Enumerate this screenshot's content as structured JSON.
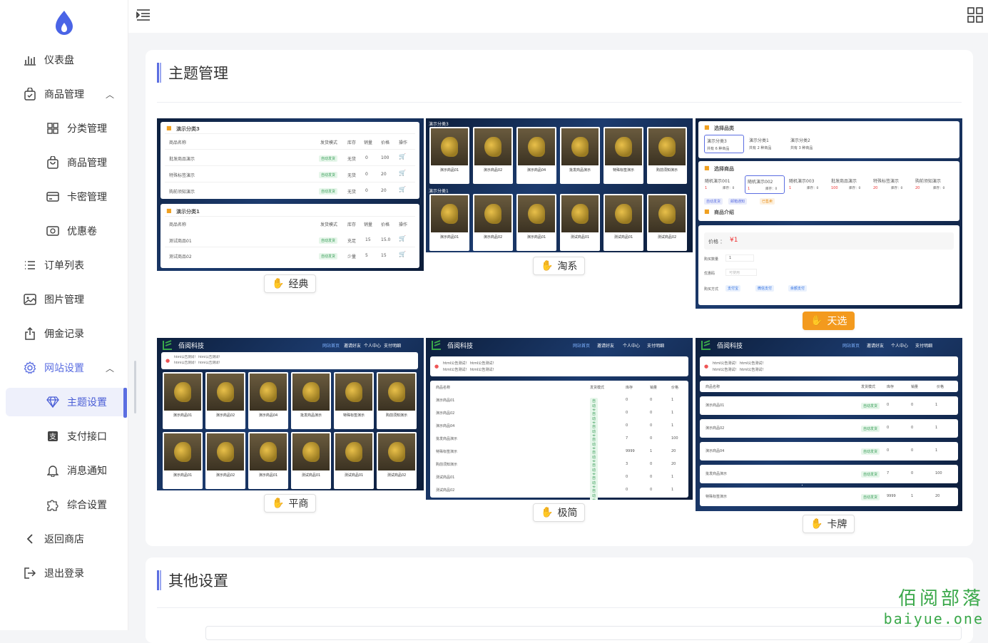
{
  "sidebar": {
    "items": [
      {
        "label": "仪表盘"
      },
      {
        "label": "商品管理"
      },
      {
        "label": "分类管理"
      },
      {
        "label": "商品管理"
      },
      {
        "label": "卡密管理"
      },
      {
        "label": "优惠卷"
      },
      {
        "label": "订单列表"
      },
      {
        "label": "图片管理"
      },
      {
        "label": "佣金记录"
      },
      {
        "label": "网站设置"
      },
      {
        "label": "主题设置"
      },
      {
        "label": "支付接口"
      },
      {
        "label": "消息通知"
      },
      {
        "label": "综合设置"
      },
      {
        "label": "返回商店"
      },
      {
        "label": "退出登录"
      }
    ]
  },
  "theme_card": {
    "title": "主题管理",
    "themes": [
      {
        "label": "经典",
        "selected": false
      },
      {
        "label": "淘系",
        "selected": false
      },
      {
        "label": "天选",
        "selected": true
      },
      {
        "label": "平商",
        "selected": false
      },
      {
        "label": "极简",
        "selected": false
      },
      {
        "label": "卡牌",
        "selected": false
      }
    ]
  },
  "other_card": {
    "title": "其他设置"
  },
  "previews": {
    "cat3": "演示分类3",
    "cat1": "演示分类1",
    "cols": [
      "商品名称",
      "发货模式",
      "库存",
      "销量",
      "价格",
      "操作"
    ],
    "classic_rows": [
      [
        "批发商品演示",
        "自动发货",
        "无货",
        "0",
        "100"
      ],
      [
        "特殊标签演示",
        "自动发货",
        "无货",
        "0",
        "20"
      ],
      [
        "购前须知演示",
        "自动发货",
        "无货",
        "0",
        "20"
      ]
    ],
    "classic_rows2": [
      [
        "测试商品01",
        "自动发货",
        "充足",
        "15",
        "15.0"
      ],
      [
        "测试商品02",
        "自动发货",
        "少量",
        "5",
        "15"
      ]
    ],
    "products": [
      "演示商品01",
      "演示商品02",
      "演示商品04",
      "批发商品演示",
      "特殊标签演示",
      "购前须知演示"
    ],
    "products2": [
      "演示商品01",
      "演示商品02",
      "演示商品01",
      "测试商品01",
      "测试商品01",
      "测试商品02"
    ],
    "brand": "佰阅科技",
    "nav": [
      "网站首页",
      "邀请好友",
      "个人中心",
      "支付明细"
    ],
    "notice1": "html公告测试！ html公告测试！",
    "notice2": "html公告测试！ html公告测试！",
    "tx_choose_cat": "选择品类",
    "tx_choose_goods": "选择商品",
    "tx_intro": "商品介绍",
    "tx_cats": [
      {
        "name": "演示分类3",
        "count": "共有 6 种商品"
      },
      {
        "name": "演示分类1",
        "count": "共有 2 种商品"
      },
      {
        "name": "演示分类2",
        "count": "共有 3 种商品"
      }
    ],
    "tx_goods": [
      {
        "name": "随机演示001",
        "stock": "库存：0",
        "price": "1"
      },
      {
        "name": "随机演示002",
        "stock": "库存：0",
        "price": "1"
      },
      {
        "name": "随机演示003",
        "stock": "库存：0",
        "price": "1"
      },
      {
        "name": "批发商品演示",
        "stock": "库存：0",
        "price": "100"
      },
      {
        "name": "特殊标签演示",
        "stock": "库存：0",
        "price": "20"
      },
      {
        "name": "购前须知演示",
        "stock": "库存：0",
        "price": "20"
      }
    ],
    "tx_tags": [
      "自动发货",
      "邮箱通知",
      "已售卖"
    ],
    "tx_price_label": "价格 ：",
    "tx_price": "¥1",
    "tx_qty_label": "购买数量",
    "tx_qty": "1",
    "tx_coupon_label": "优惠码",
    "tx_coupon_ph": "可使用",
    "tx_pay_label": "购买方式",
    "tx_pays": [
      "支付宝",
      "微信支付",
      "余额支付"
    ],
    "jj_rows": [
      [
        "演示商品01",
        "自动发货",
        "0",
        "0",
        "1"
      ],
      [
        "演示商品02",
        "自动发货",
        "0",
        "0",
        "1"
      ],
      [
        "演示商品04",
        "自动发货",
        "0",
        "0",
        "1"
      ],
      [
        "批发商品演示",
        "自动发货",
        "7",
        "0",
        "100"
      ],
      [
        "特殊标签演示",
        "自动发货",
        "9999",
        "1",
        "20"
      ],
      [
        "购前须知演示",
        "自动发货",
        "3",
        "0",
        "20"
      ],
      [
        "测试商品01",
        "自动发货",
        "0",
        "0",
        "1"
      ],
      [
        "测试商品02",
        "自动发货",
        "0",
        "0",
        "1"
      ]
    ],
    "kp_rows": [
      [
        "演示商品01",
        "自动发货",
        "0",
        "0",
        "1"
      ],
      [
        "演示商品02",
        "自动发货",
        "0",
        "0",
        "1"
      ],
      [
        "演示商品04",
        "自动发货",
        "0",
        "0",
        "1"
      ],
      [
        "批发商品演示",
        "自动发货",
        "7",
        "0",
        "100"
      ],
      [
        "特殊标签演示",
        "自动发货",
        "9999",
        "1",
        "20"
      ]
    ],
    "kp_cols": [
      "商品名称",
      "发货模式",
      "库存",
      "销量",
      "价格"
    ]
  },
  "watermark": {
    "line1": "佰阅部落",
    "line2": "baiyue.one"
  },
  "colors": {
    "accent": "#5b6ee1",
    "selected_btn": "#f39a1e"
  }
}
